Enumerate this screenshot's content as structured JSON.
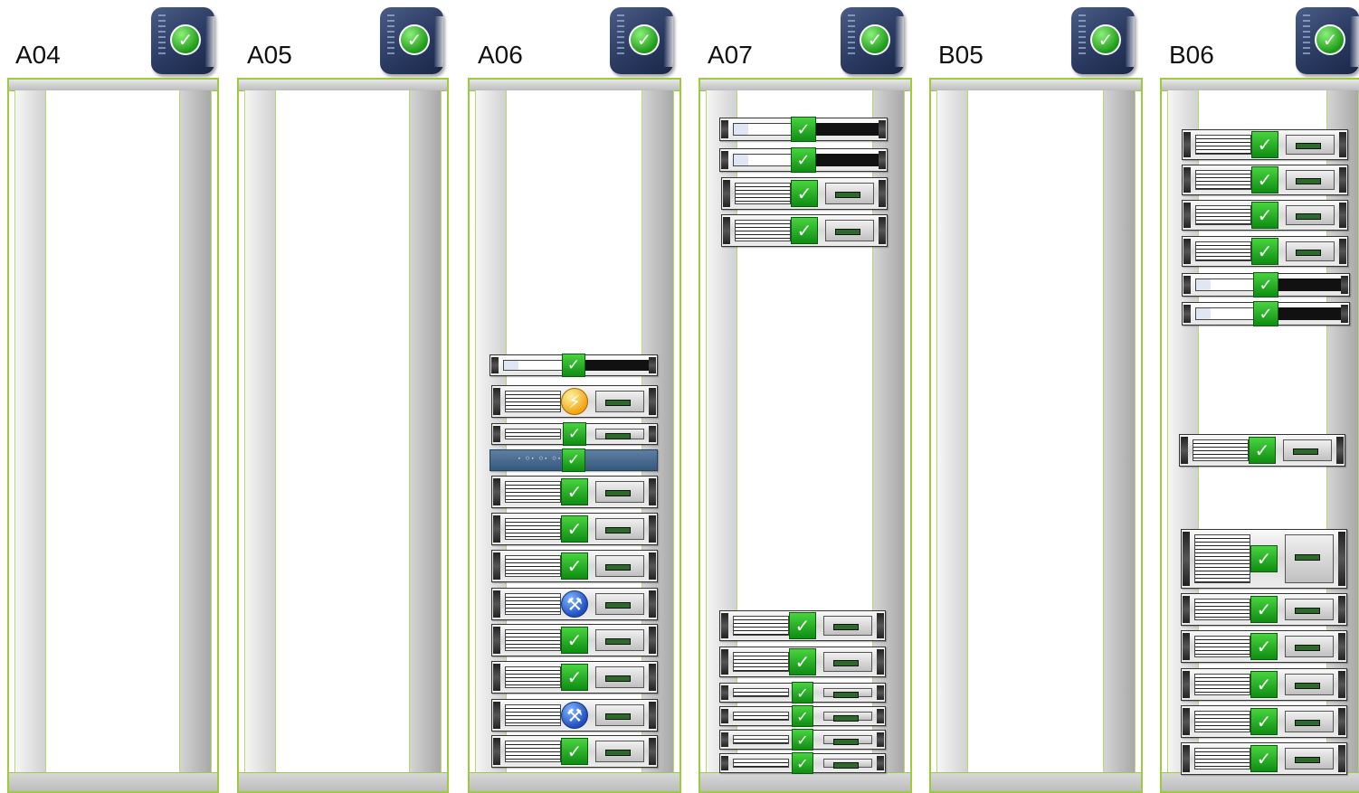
{
  "colors": {
    "rack_frame": "#9ccc3c",
    "status_ok": "#1f9a1c",
    "status_warning": "#f2a414",
    "status_maintenance": "#1f4fc2",
    "pdu_body": "#2a3a61"
  },
  "racks": [
    {
      "id": "rack-a04",
      "label": "A04",
      "pdu": {
        "icon": "pdu-icon",
        "status": "ok",
        "status_icon": "check-circle-icon"
      },
      "units": []
    },
    {
      "id": "rack-a05",
      "label": "A05",
      "pdu": {
        "icon": "pdu-icon",
        "status": "ok",
        "status_icon": "check-circle-icon"
      },
      "units": []
    },
    {
      "id": "rack-a06",
      "label": "A06",
      "pdu": {
        "icon": "pdu-icon",
        "status": "ok",
        "status_icon": "check-circle-icon"
      },
      "units": [
        {
          "type": "storage",
          "status": "ok"
        },
        {
          "type": "server",
          "status": "warning"
        },
        {
          "type": "server-1u",
          "status": "ok"
        },
        {
          "type": "switch",
          "status": "ok"
        },
        {
          "type": "server",
          "status": "ok"
        },
        {
          "type": "server",
          "status": "ok"
        },
        {
          "type": "server",
          "status": "ok"
        },
        {
          "type": "server",
          "status": "maintenance"
        },
        {
          "type": "server",
          "status": "ok"
        },
        {
          "type": "server",
          "status": "ok"
        },
        {
          "type": "server",
          "status": "maintenance"
        },
        {
          "type": "server",
          "status": "ok"
        }
      ]
    },
    {
      "id": "rack-a07",
      "label": "A07",
      "pdu": {
        "icon": "pdu-icon",
        "status": "ok",
        "status_icon": "check-circle-icon"
      },
      "units": [
        {
          "type": "storage",
          "status": "ok"
        },
        {
          "type": "storage",
          "status": "ok"
        },
        {
          "type": "server",
          "status": "ok"
        },
        {
          "type": "server",
          "status": "ok"
        },
        {
          "type": "server",
          "status": "ok"
        },
        {
          "type": "server",
          "status": "ok"
        },
        {
          "type": "server-1u",
          "status": "ok"
        },
        {
          "type": "server-1u",
          "status": "ok"
        },
        {
          "type": "server-1u",
          "status": "ok"
        },
        {
          "type": "server-1u",
          "status": "ok"
        }
      ]
    },
    {
      "id": "rack-b05",
      "label": "B05",
      "pdu": {
        "icon": "pdu-icon",
        "status": "ok",
        "status_icon": "check-circle-icon"
      },
      "units": []
    },
    {
      "id": "rack-b06",
      "label": "B06",
      "pdu": {
        "icon": "pdu-icon",
        "status": "ok",
        "status_icon": "check-circle-icon"
      },
      "units": [
        {
          "type": "server",
          "status": "ok"
        },
        {
          "type": "server",
          "status": "ok"
        },
        {
          "type": "server",
          "status": "ok"
        },
        {
          "type": "server",
          "status": "ok"
        },
        {
          "type": "storage",
          "status": "ok"
        },
        {
          "type": "storage",
          "status": "ok"
        },
        {
          "type": "server",
          "status": "ok"
        },
        {
          "type": "server-2u",
          "status": "ok"
        },
        {
          "type": "server",
          "status": "ok"
        },
        {
          "type": "server",
          "status": "ok"
        },
        {
          "type": "server",
          "status": "ok"
        },
        {
          "type": "server",
          "status": "ok"
        },
        {
          "type": "server",
          "status": "ok"
        }
      ]
    }
  ]
}
